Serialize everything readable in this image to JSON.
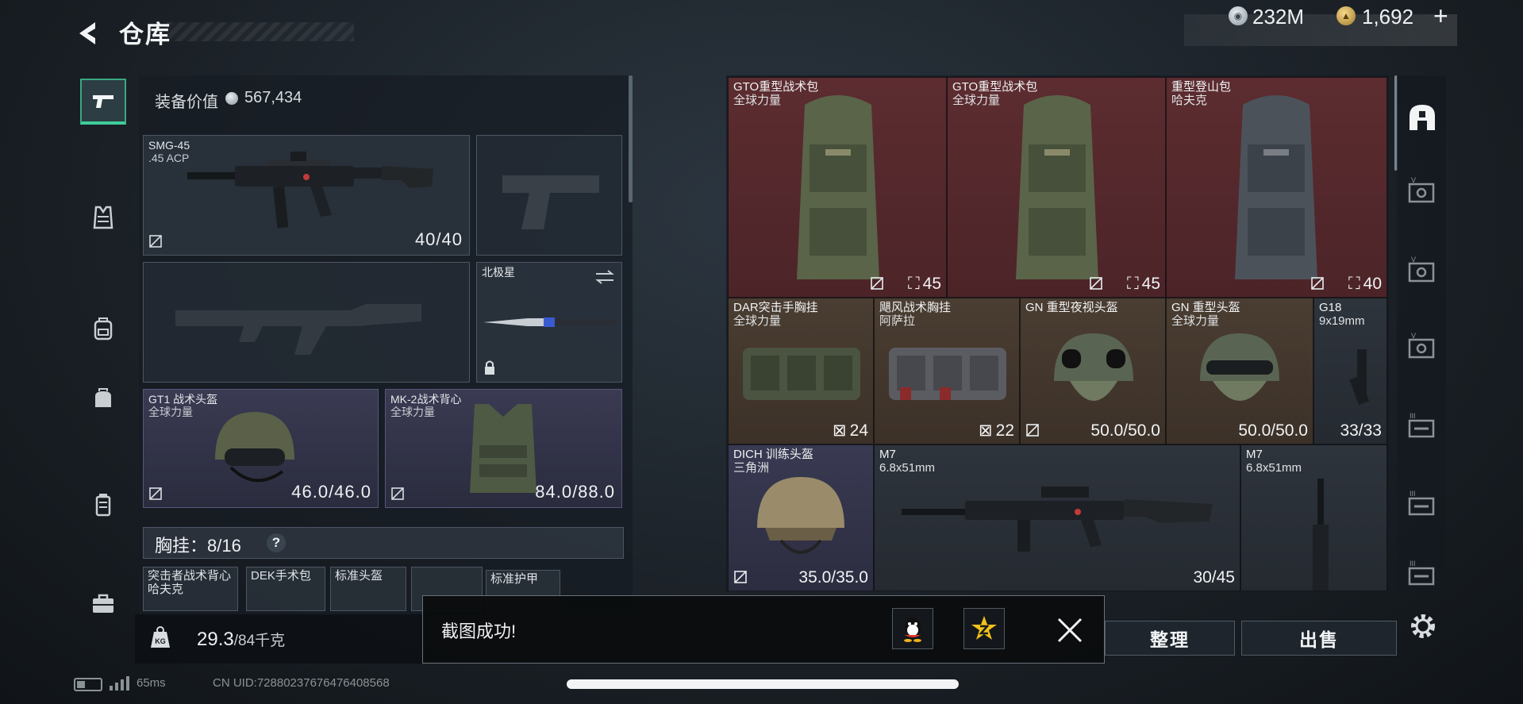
{
  "header": {
    "title": "仓库",
    "currency_silver": "232M",
    "currency_gold": "1,692",
    "add_label": "+"
  },
  "left_rail": [
    {
      "name": "weapons",
      "icon": "pistol-icon",
      "active": true
    },
    {
      "name": "vest",
      "icon": "vest-icon"
    },
    {
      "name": "backpack",
      "icon": "backpack-icon"
    },
    {
      "name": "bag",
      "icon": "bag-icon"
    },
    {
      "name": "jar",
      "icon": "container-icon"
    },
    {
      "name": "case",
      "icon": "briefcase-icon"
    }
  ],
  "loadout": {
    "equip_value_label": "装备价值",
    "equip_value": "567,434",
    "primary": {
      "name": "SMG-45",
      "ammo": ".45 ACP",
      "durability": "40/40"
    },
    "melee": {
      "name": "北极星"
    },
    "helmet": {
      "name": "GT1 战术头盔",
      "faction": "全球力量",
      "durability": "46.0/46.0"
    },
    "armor": {
      "name": "MK-2战术背心",
      "faction": "全球力量",
      "durability": "84.0/88.0"
    },
    "rig_label": "胸挂：8/16",
    "rig_help": "?",
    "mini_slots": [
      {
        "line1": "突击者战术背心",
        "line2": "哈夫克"
      },
      {
        "line1": "DEK手术包",
        "line2": ""
      },
      {
        "line1": "标准头盔",
        "line2": ""
      },
      {
        "line1": "标准护甲",
        "line2": ""
      }
    ],
    "weight": "29.3",
    "weight_max": "/84千克",
    "kg_label": "KG"
  },
  "inventory": [
    {
      "name": "GTO重型战术包",
      "faction": "全球力量",
      "stat": "45",
      "rarity": "red"
    },
    {
      "name": "GTO重型战术包",
      "faction": "全球力量",
      "stat": "45",
      "rarity": "red"
    },
    {
      "name": "重型登山包",
      "faction": "哈夫克",
      "stat": "40",
      "rarity": "red"
    },
    {
      "name": "DAR突击手胸挂",
      "faction": "全球力量",
      "stat": "24",
      "rarity": "brown"
    },
    {
      "name": "飓风战术胸挂",
      "faction": "阿萨拉",
      "stat": "22",
      "rarity": "brown"
    },
    {
      "name": "GN 重型夜视头盔",
      "faction": "",
      "stat": "50.0/50.0",
      "rarity": "brown"
    },
    {
      "name": "GN 重型头盔",
      "faction": "全球力量",
      "stat": "50.0/50.0",
      "rarity": "brown"
    },
    {
      "name": "G18",
      "faction": "9x19mm",
      "stat": "33/33",
      "rarity": "gray"
    },
    {
      "name": "DICH 训练头盔",
      "faction": "三角洲",
      "stat": "35.0/35.0",
      "rarity": "purple"
    },
    {
      "name": "M7",
      "faction": "6.8x51mm",
      "stat": "30/45",
      "rarity": "gray"
    },
    {
      "name": "M7",
      "faction": "6.8x51mm",
      "stat": "",
      "rarity": "gray"
    }
  ],
  "buttons": {
    "sort": "整理",
    "sell": "出售"
  },
  "toast": {
    "message": "截图成功!"
  },
  "status": {
    "ping": "65ms",
    "uid": "CN UID:7288023767647640856​8"
  },
  "colors": {
    "red_rarity": "#5c2c30",
    "gold_rarity": "#4a3d32",
    "purple_rarity": "#393a52",
    "accent_green": "#3fcc9a"
  }
}
